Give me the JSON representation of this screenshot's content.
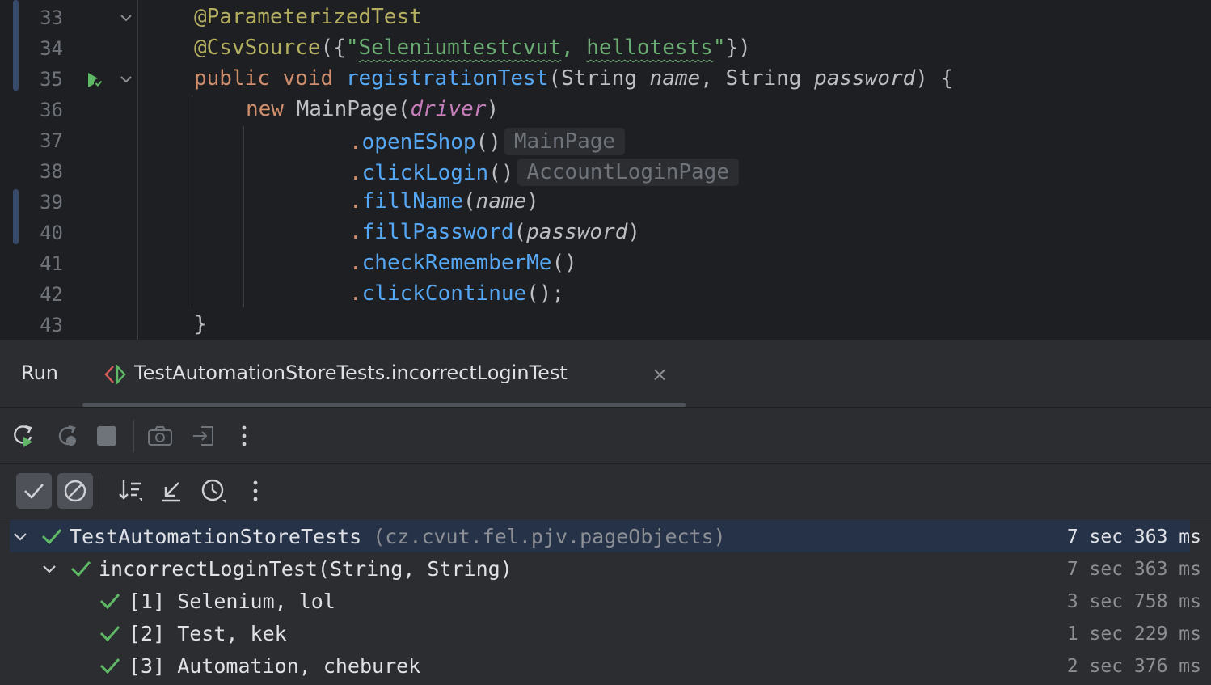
{
  "editor": {
    "lines": [
      {
        "num": "33"
      },
      {
        "num": "34"
      },
      {
        "num": "35"
      },
      {
        "num": "36"
      },
      {
        "num": "37"
      },
      {
        "num": "38"
      },
      {
        "num": "39"
      },
      {
        "num": "40"
      },
      {
        "num": "41"
      },
      {
        "num": "42"
      },
      {
        "num": "43"
      }
    ],
    "code": {
      "l33_annotation": "@ParameterizedTest",
      "l34_annotation": "@CsvSource",
      "l34_open": "({",
      "l34_quote_open": "\"",
      "l34_str1": "Seleniumtestcvut",
      "l34_sep": ", ",
      "l34_str2": "hellotests",
      "l34_quote_close": "\"",
      "l34_close": "})",
      "l35_public": "public",
      "l35_void": "void",
      "l35_method": "registrationTest",
      "l35_open": "(String ",
      "l35_p1": "name",
      "l35_mid": ", String ",
      "l35_p2": "password",
      "l35_close": ") {",
      "l36_new": "new",
      "l36_class": " MainPage(",
      "l36_field": "driver",
      "l36_close": ")",
      "l37_call": "openEShop",
      "l37_parens": "()",
      "l37_hint": "MainPage",
      "l38_call": "clickLogin",
      "l38_parens": "()",
      "l38_hint": "AccountLoginPage",
      "l39_call": "fillName",
      "l39_open": "(",
      "l39_arg": "name",
      "l39_close": ")",
      "l40_call": "fillPassword",
      "l40_open": "(",
      "l40_arg": "password",
      "l40_close": ")",
      "l41_call": "checkRememberMe",
      "l41_parens": "()",
      "l42_call": "clickContinue",
      "l42_parens": "();",
      "l43_brace": "}",
      "dot": "."
    }
  },
  "run": {
    "title": "Run",
    "tab_label": "TestAutomationStoreTests.incorrectLoginTest",
    "tab_close": "×"
  },
  "tree": {
    "root": {
      "name": "TestAutomationStoreTests",
      "pkg": "(cz.cvut.fel.pjv.pageObjects)",
      "time": "7 sec 363 ms"
    },
    "method": {
      "name": "incorrectLoginTest(String, String)",
      "time": "7 sec 363 ms"
    },
    "cases": [
      {
        "name": "[1] Selenium, lol",
        "time": "3 sec 758 ms"
      },
      {
        "name": "[2] Test, kek",
        "time": "1 sec 229 ms"
      },
      {
        "name": "[3] Automation, cheburek",
        "time": "2 sec 376 ms"
      }
    ]
  },
  "colors": {
    "editor_bg": "#1e1f22",
    "panel_bg": "#2b2d30",
    "keyword": "#cf8e6d",
    "string": "#6aab73",
    "function": "#56a8f5",
    "annotation": "#b3ae60",
    "field": "#c77dbb",
    "pass": "#5fb865",
    "selection": "#253248"
  },
  "icons": [
    "fold-chevron-icon",
    "run-passed-icon",
    "rerun-icon",
    "rerun-failed-icon",
    "stop-icon",
    "screenshot-icon",
    "export-icon",
    "more-icon",
    "show-passed-icon",
    "show-ignored-icon",
    "sort-icon",
    "collapse-icon",
    "history-icon",
    "check-icon",
    "chevron-down-icon",
    "close-icon"
  ]
}
